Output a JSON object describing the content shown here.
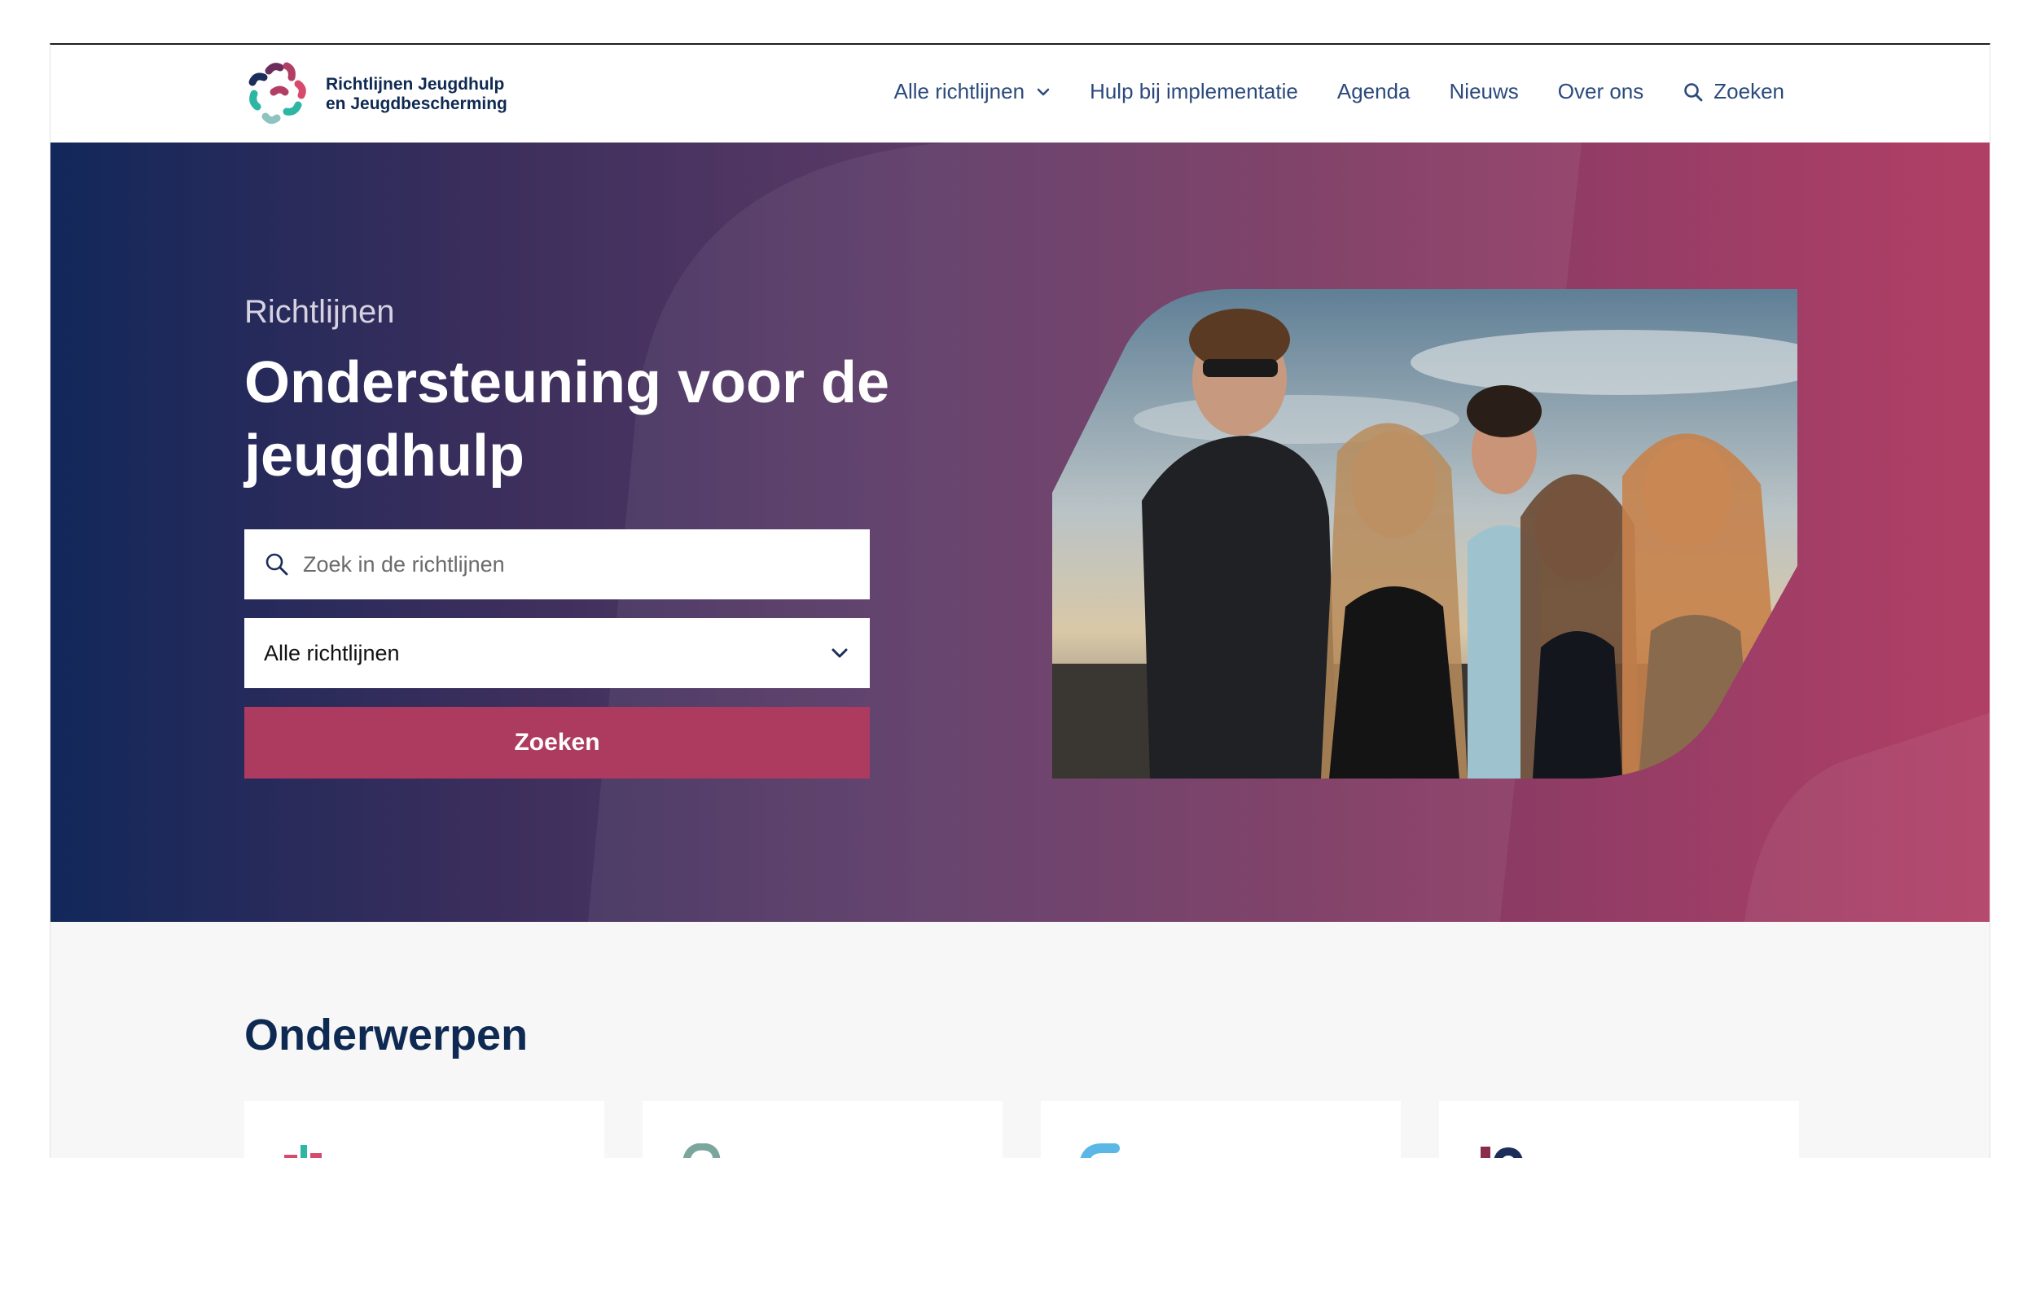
{
  "header": {
    "logo_line1": "Richtlijnen Jeugdhulp",
    "logo_line2": "en Jeugdbescherming",
    "nav": [
      {
        "label": "Alle richtlijnen",
        "icon": "chevron-down-icon"
      },
      {
        "label": "Hulp bij implementatie"
      },
      {
        "label": "Agenda"
      },
      {
        "label": "Nieuws"
      },
      {
        "label": "Over ons"
      },
      {
        "label": "Zoeken",
        "icon": "search-icon"
      }
    ]
  },
  "hero": {
    "kicker": "Richtlijnen",
    "title": "Ondersteuning voor de jeugdhulp",
    "search_placeholder": "Zoek in de richtlijnen",
    "select_value": "Alle richtlijnen",
    "button_label": "Zoeken",
    "photo": "group-of-young-people-photo"
  },
  "topics": {
    "title": "Onderwerpen",
    "cards": [
      {
        "icon": "topic-icon-teal-pink"
      },
      {
        "icon": "topic-icon-green"
      },
      {
        "icon": "topic-icon-lightblue"
      },
      {
        "icon": "topic-icon-navy-maroon"
      }
    ]
  },
  "colors": {
    "brand_navy": "#0f2a52",
    "nav_text": "#2b4a7c",
    "button": "#ad3a5f",
    "hero_gradient_start": "#12275a",
    "hero_gradient_end": "#b13f65"
  }
}
